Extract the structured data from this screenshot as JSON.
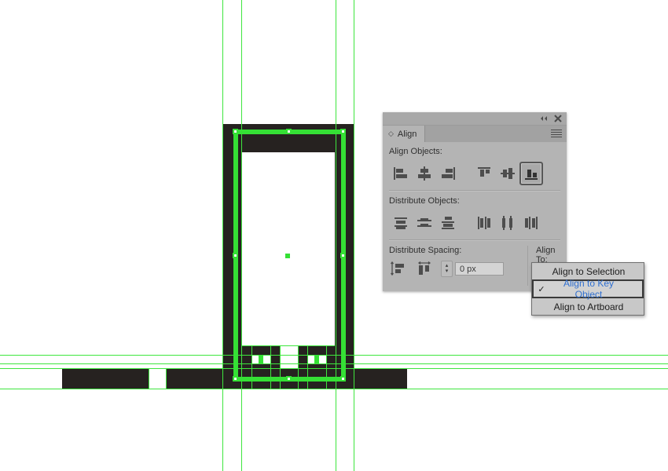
{
  "app": {
    "name": "Illustrator Align Panel"
  },
  "panel": {
    "title": "Align",
    "diamond_glyph": "◇",
    "collapse_icon": "collapse-icon",
    "close_icon": "close-icon",
    "menu_icon": "panel-menu-icon",
    "sections": {
      "align_objects_label": "Align Objects:",
      "distribute_objects_label": "Distribute Objects:",
      "distribute_spacing_label": "Distribute Spacing:",
      "align_to_label": "Align To:"
    },
    "align_objects_buttons": [
      {
        "name": "horizontal-align-left",
        "selected": false
      },
      {
        "name": "horizontal-align-center",
        "selected": false
      },
      {
        "name": "horizontal-align-right",
        "selected": false
      },
      {
        "name": "vertical-align-top",
        "selected": false
      },
      {
        "name": "vertical-align-center",
        "selected": false
      },
      {
        "name": "vertical-align-bottom",
        "selected": true
      }
    ],
    "distribute_objects_buttons": [
      {
        "name": "vertical-distribute-top",
        "selected": false
      },
      {
        "name": "vertical-distribute-center",
        "selected": false
      },
      {
        "name": "vertical-distribute-bottom",
        "selected": false
      },
      {
        "name": "horizontal-distribute-left",
        "selected": false
      },
      {
        "name": "horizontal-distribute-center",
        "selected": false
      },
      {
        "name": "horizontal-distribute-right",
        "selected": false
      }
    ],
    "distribute_spacing_buttons": [
      {
        "name": "vertical-distribute-spacing",
        "selected": false
      },
      {
        "name": "horizontal-distribute-spacing",
        "selected": false
      }
    ],
    "spacing_value": "0 px",
    "spacing_placeholder": "0 px",
    "stepper_up_glyph": "▴",
    "stepper_down_glyph": "▾",
    "align_to_button_icon": "align-to-key-object-icon",
    "align_to_chevron": "⌄"
  },
  "dropdown": {
    "items": [
      {
        "label": "Align to Selection",
        "checked": false,
        "active": false
      },
      {
        "label": "Align to Key Object",
        "checked": true,
        "active": true
      },
      {
        "label": "Align to Artboard",
        "checked": false,
        "active": false
      }
    ],
    "check_glyph": "✓"
  },
  "colors": {
    "artwork": "#262220",
    "guide_green": "#3ee63e",
    "selection_green": "#35e035",
    "panel_bg": "#b4b4b4",
    "panel_tabbar": "#a2a2a2",
    "dropdown_bg": "#c8c8c8",
    "active_text_blue": "#2f6fd0",
    "canvas_bg": "#ffffff"
  },
  "canvas": {
    "description": "Vector artwork of a black rectangular arch shape with selection bounding box and smart guides"
  }
}
